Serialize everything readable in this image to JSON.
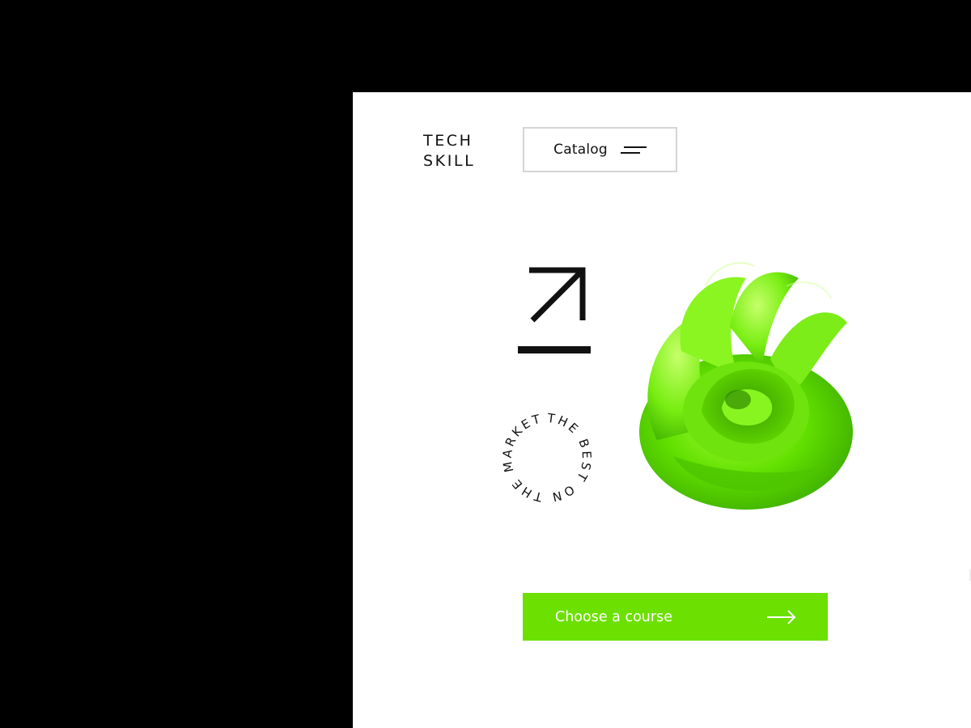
{
  "brand": {
    "line1": "TECH",
    "line2": "SKILL"
  },
  "header": {
    "catalog_label": "Catalog",
    "catalog_icon": "hamburger-menu-icon"
  },
  "hero": {
    "arrow_icon": "arrow-up-right-icon",
    "badge_text": "THE BEST ON THE MARKET ",
    "image": "green-3d-swirl-shape"
  },
  "cta": {
    "label": "Choose a course",
    "icon": "arrow-right-icon"
  },
  "colors": {
    "background": "#000000",
    "panel": "#ffffff",
    "accent": "#6ce000",
    "text": "#111111",
    "border": "#d4d4d4"
  }
}
